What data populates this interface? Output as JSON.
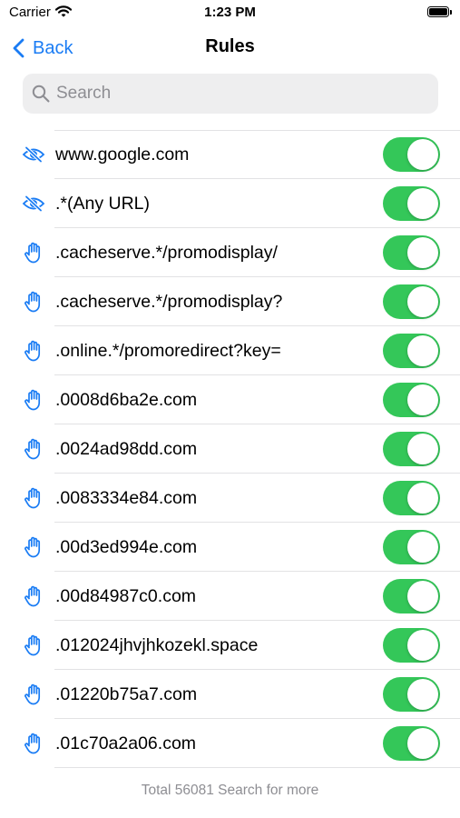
{
  "status_bar": {
    "carrier": "Carrier",
    "time": "1:23 PM"
  },
  "nav": {
    "back_label": "Back",
    "title": "Rules"
  },
  "search": {
    "placeholder": "Search",
    "value": ""
  },
  "colors": {
    "accent": "#1a7cf4",
    "toggle_on": "#34c759",
    "search_bg": "#eeeeef",
    "secondary_text": "#8e8e93"
  },
  "rules": [
    {
      "icon": "eye-slash-icon",
      "text": "www.google.com",
      "enabled": true
    },
    {
      "icon": "eye-slash-icon",
      "text": ".*(Any URL)",
      "enabled": true
    },
    {
      "icon": "hand-stop-icon",
      "text": ".cacheserve.*/promodisplay/",
      "enabled": true
    },
    {
      "icon": "hand-stop-icon",
      "text": ".cacheserve.*/promodisplay?",
      "enabled": true
    },
    {
      "icon": "hand-stop-icon",
      "text": ".online.*/promoredirect?key=",
      "enabled": true
    },
    {
      "icon": "hand-stop-icon",
      "text": ".0008d6ba2e.com",
      "enabled": true
    },
    {
      "icon": "hand-stop-icon",
      "text": ".0024ad98dd.com",
      "enabled": true
    },
    {
      "icon": "hand-stop-icon",
      "text": ".0083334e84.com",
      "enabled": true
    },
    {
      "icon": "hand-stop-icon",
      "text": ".00d3ed994e.com",
      "enabled": true
    },
    {
      "icon": "hand-stop-icon",
      "text": ".00d84987c0.com",
      "enabled": true
    },
    {
      "icon": "hand-stop-icon",
      "text": ".012024jhvjhkozekl.space",
      "enabled": true
    },
    {
      "icon": "hand-stop-icon",
      "text": ".01220b75a7.com",
      "enabled": true
    },
    {
      "icon": "hand-stop-icon",
      "text": ".01c70a2a06.com",
      "enabled": true
    }
  ],
  "footer": {
    "text": "Total 56081 Search for more"
  }
}
